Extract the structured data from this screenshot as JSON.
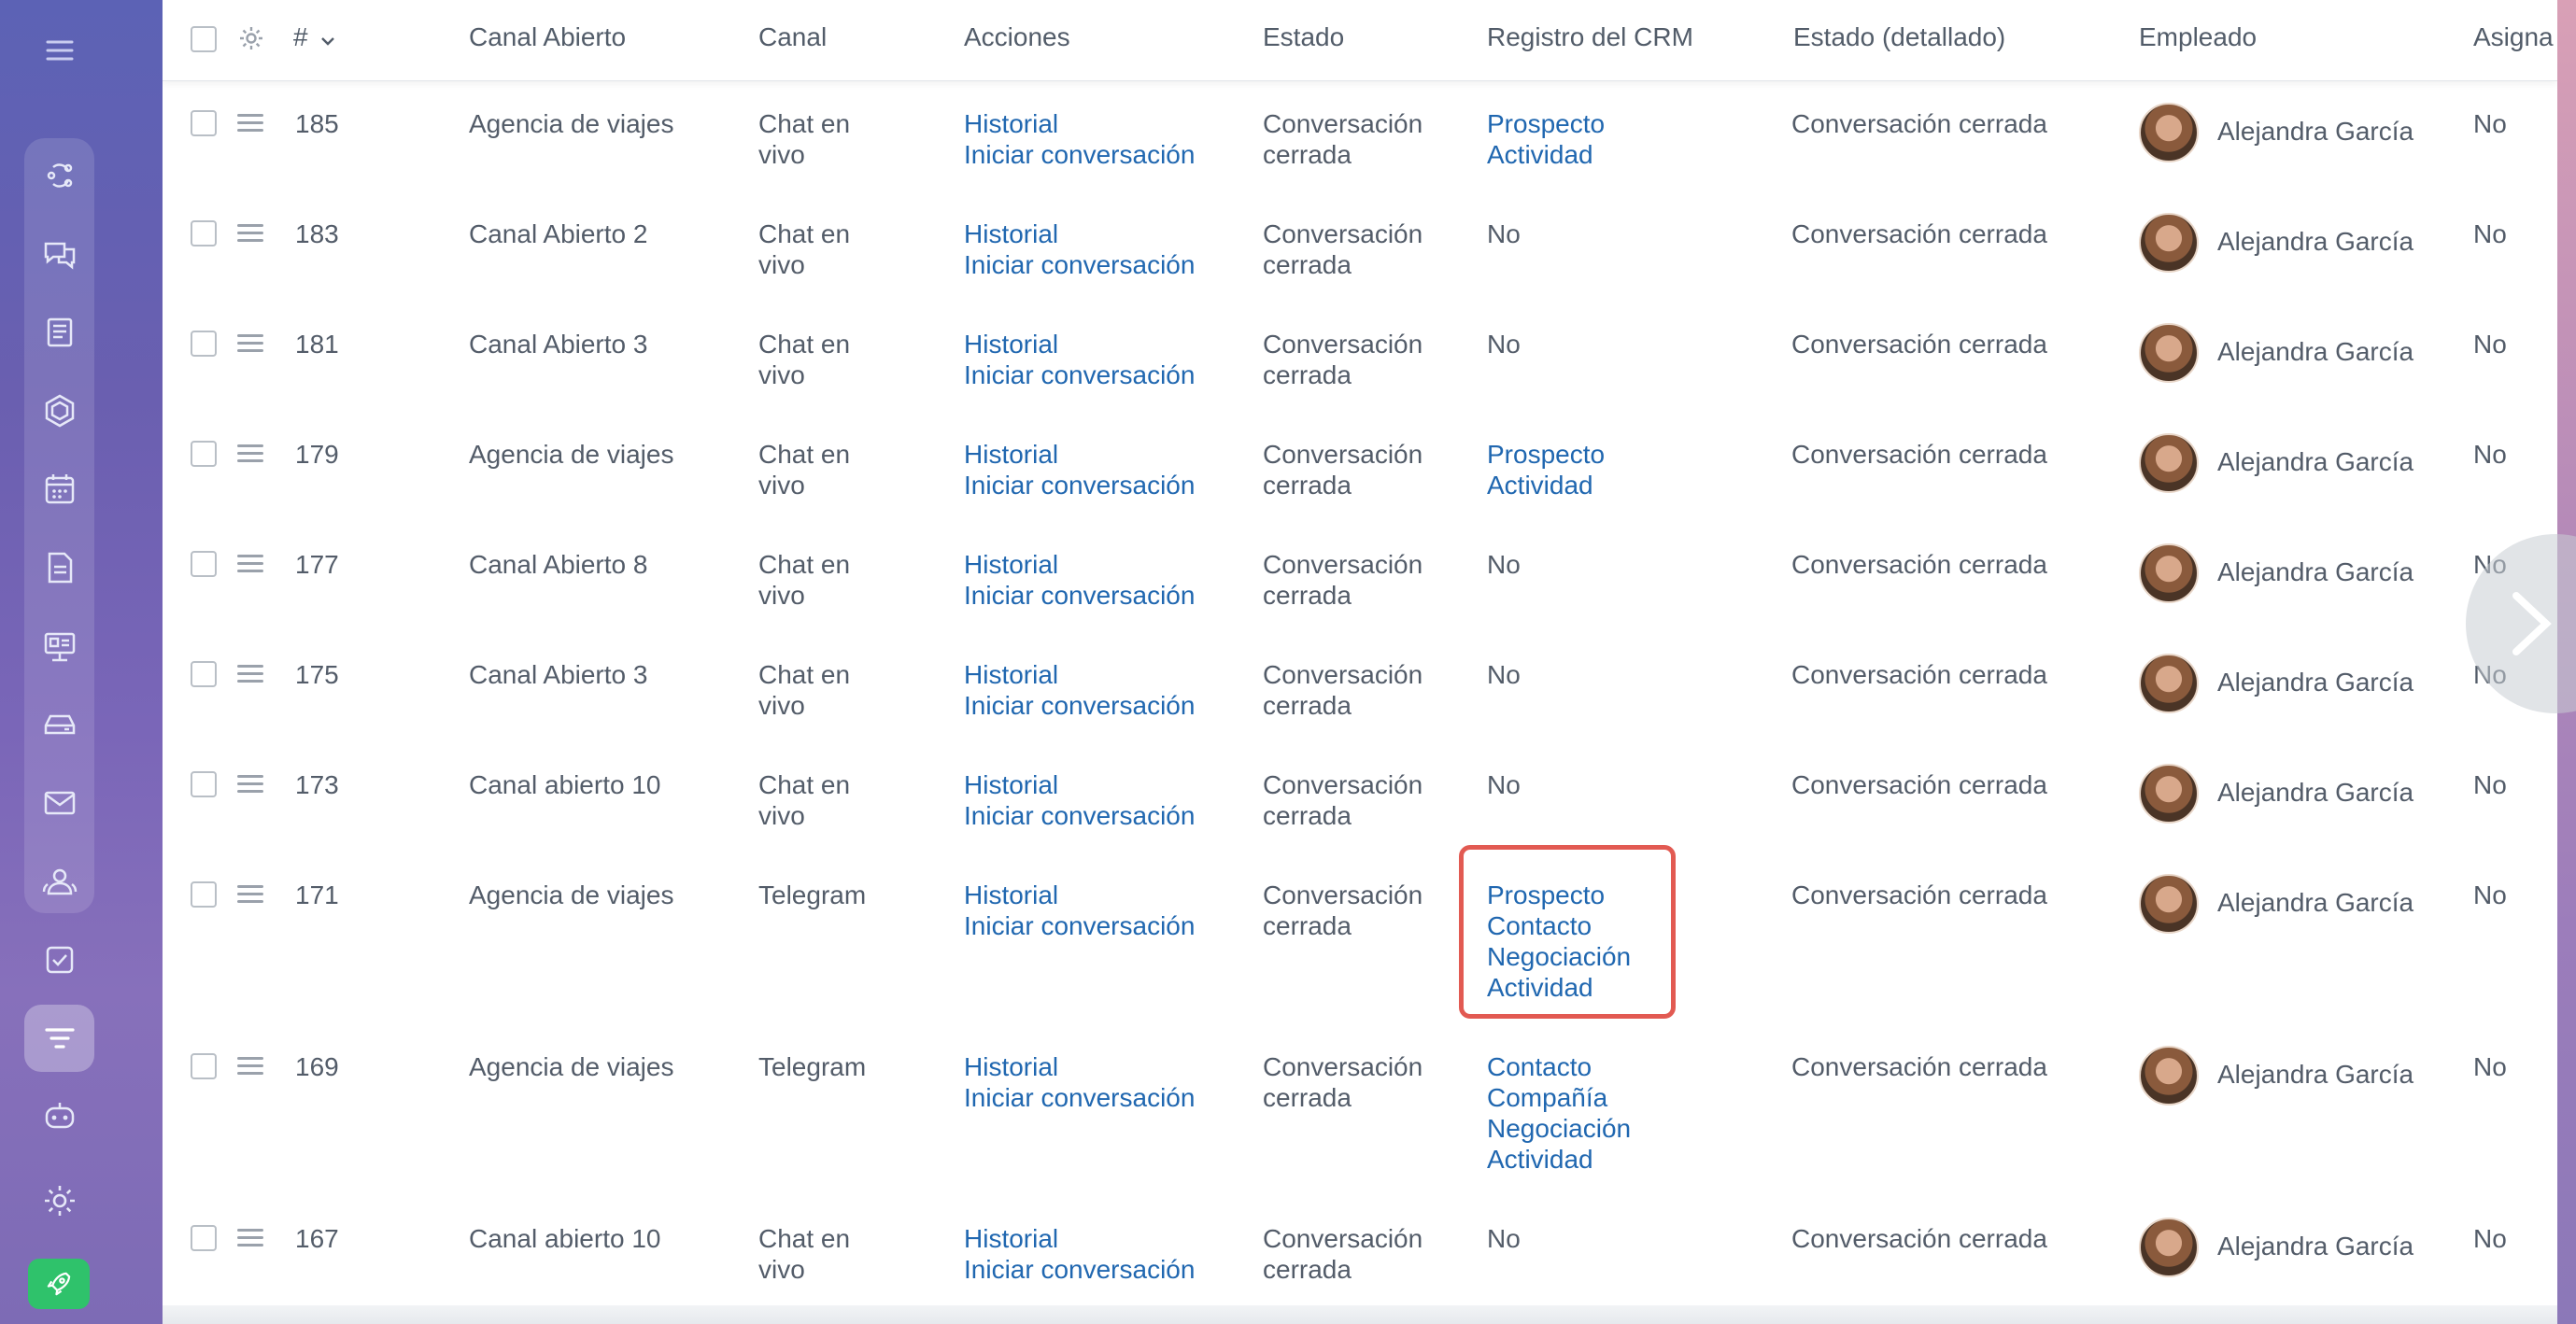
{
  "header": {
    "hash": "#",
    "columns": [
      "Canal Abierto",
      "Canal",
      "Acciones",
      "Estado",
      "Registro del CRM",
      "Estado (detallado)",
      "Empleado",
      "Asigna"
    ]
  },
  "rows": [
    {
      "id": "185",
      "open_channel": "Agencia de viajes",
      "channel": [
        "Chat en",
        "vivo"
      ],
      "actions": [
        "Historial",
        "Iniciar conversación"
      ],
      "status": [
        "Conversación",
        "cerrada"
      ],
      "crm": [
        "Prospecto",
        "Actividad"
      ],
      "crm_is_link": true,
      "detailed_status": "Conversación cerrada",
      "employee": "Alejandra García",
      "assigned": "No"
    },
    {
      "id": "183",
      "open_channel": "Canal Abierto 2",
      "channel": [
        "Chat en",
        "vivo"
      ],
      "actions": [
        "Historial",
        "Iniciar conversación"
      ],
      "status": [
        "Conversación",
        "cerrada"
      ],
      "crm": [
        "No"
      ],
      "crm_is_link": false,
      "detailed_status": "Conversación cerrada",
      "employee": "Alejandra García",
      "assigned": "No"
    },
    {
      "id": "181",
      "open_channel": "Canal Abierto 3",
      "channel": [
        "Chat en",
        "vivo"
      ],
      "actions": [
        "Historial",
        "Iniciar conversación"
      ],
      "status": [
        "Conversación",
        "cerrada"
      ],
      "crm": [
        "No"
      ],
      "crm_is_link": false,
      "detailed_status": "Conversación cerrada",
      "employee": "Alejandra García",
      "assigned": "No"
    },
    {
      "id": "179",
      "open_channel": "Agencia de viajes",
      "channel": [
        "Chat en",
        "vivo"
      ],
      "actions": [
        "Historial",
        "Iniciar conversación"
      ],
      "status": [
        "Conversación",
        "cerrada"
      ],
      "crm": [
        "Prospecto",
        "Actividad"
      ],
      "crm_is_link": true,
      "detailed_status": "Conversación cerrada",
      "employee": "Alejandra García",
      "assigned": "No"
    },
    {
      "id": "177",
      "open_channel": "Canal Abierto 8",
      "channel": [
        "Chat en",
        "vivo"
      ],
      "actions": [
        "Historial",
        "Iniciar conversación"
      ],
      "status": [
        "Conversación",
        "cerrada"
      ],
      "crm": [
        "No"
      ],
      "crm_is_link": false,
      "detailed_status": "Conversación cerrada",
      "employee": "Alejandra García",
      "assigned": "No"
    },
    {
      "id": "175",
      "open_channel": "Canal Abierto 3",
      "channel": [
        "Chat en",
        "vivo"
      ],
      "actions": [
        "Historial",
        "Iniciar conversación"
      ],
      "status": [
        "Conversación",
        "cerrada"
      ],
      "crm": [
        "No"
      ],
      "crm_is_link": false,
      "detailed_status": "Conversación cerrada",
      "employee": "Alejandra García",
      "assigned": "No"
    },
    {
      "id": "173",
      "open_channel": "Canal abierto 10",
      "channel": [
        "Chat en",
        "vivo"
      ],
      "actions": [
        "Historial",
        "Iniciar conversación"
      ],
      "status": [
        "Conversación",
        "cerrada"
      ],
      "crm": [
        "No"
      ],
      "crm_is_link": false,
      "detailed_status": "Conversación cerrada",
      "employee": "Alejandra García",
      "assigned": "No"
    },
    {
      "id": "171",
      "open_channel": "Agencia de viajes",
      "channel": [
        "Telegram"
      ],
      "actions": [
        "Historial",
        "Iniciar conversación"
      ],
      "status": [
        "Conversación",
        "cerrada"
      ],
      "crm": [
        "Prospecto",
        "Contacto",
        "Negociación",
        "Actividad"
      ],
      "crm_is_link": true,
      "detailed_status": "Conversación cerrada",
      "employee": "Alejandra García",
      "assigned": "No"
    },
    {
      "id": "169",
      "open_channel": "Agencia de viajes",
      "channel": [
        "Telegram"
      ],
      "actions": [
        "Historial",
        "Iniciar conversación"
      ],
      "status": [
        "Conversación",
        "cerrada"
      ],
      "crm": [
        "Contacto",
        "Compañía",
        "Negociación",
        "Actividad"
      ],
      "crm_is_link": true,
      "detailed_status": "Conversación cerrada",
      "employee": "Alejandra García",
      "assigned": "No"
    },
    {
      "id": "167",
      "open_channel": "Canal abierto 10",
      "channel": [
        "Chat en",
        "vivo"
      ],
      "actions": [
        "Historial",
        "Iniciar conversación"
      ],
      "status": [
        "Conversación",
        "cerrada"
      ],
      "crm": [
        "No"
      ],
      "crm_is_link": false,
      "detailed_status": "Conversación cerrada",
      "employee": "Alejandra García",
      "assigned": "No"
    }
  ],
  "sidebar": {
    "icons": [
      "menu-icon",
      "funnel-share-icon",
      "chat-bubbles-icon",
      "newspaper-icon",
      "hexagon-icon",
      "calendar-icon",
      "document-icon",
      "presentation-icon",
      "storage-icon",
      "mail-icon",
      "contacts-icon",
      "checkbox-task-icon",
      "filter-list-icon",
      "robot-icon",
      "gear-icon",
      "rocket-icon"
    ],
    "active": "filter-list-icon"
  },
  "colors": {
    "link": "#2067b0",
    "text": "#535c69",
    "highlight": "#e25a52",
    "rocket": "#2fc26b"
  }
}
